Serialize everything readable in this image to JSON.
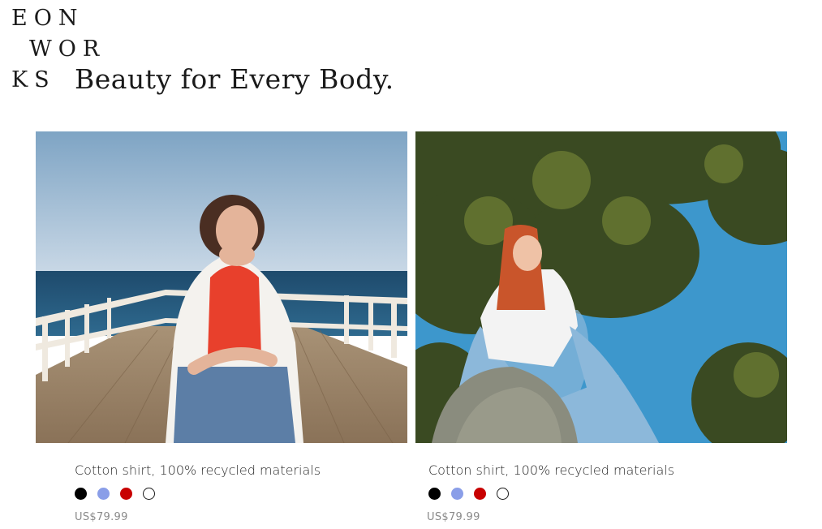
{
  "brand": {
    "logo_line1": "EON",
    "logo_line2": "WOR",
    "logo_line3": "KS",
    "tagline": "Beauty for Every Body."
  },
  "products": [
    {
      "name": "Cotton shirt, 100% recycled materials",
      "price": "US$79.99",
      "image_alt": "Woman in white open shirt and red top on a seaside pier",
      "colors": [
        "#000000",
        "#8a9ee8",
        "#c80000",
        "#ffffff"
      ]
    },
    {
      "name": "Cotton shirt, 100% recycled materials",
      "price": "US$79.99",
      "image_alt": "Red-haired woman in white t-shirt sitting on a rock under a tree",
      "colors": [
        "#000000",
        "#8a9ee8",
        "#c80000",
        "#ffffff"
      ]
    }
  ]
}
